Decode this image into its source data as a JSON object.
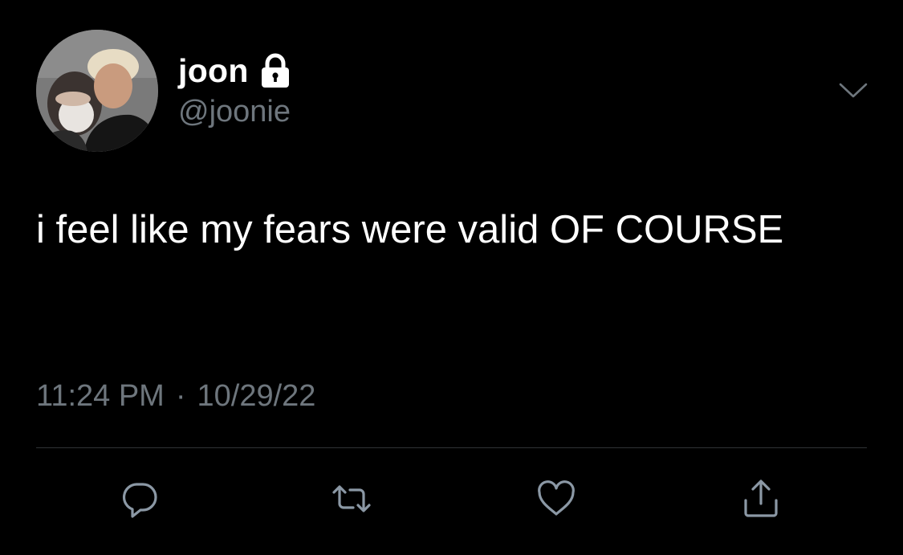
{
  "author": {
    "display_name": "joon",
    "handle": "@joonie",
    "protected": true,
    "avatar": "profile-photo"
  },
  "tweet": {
    "text": "i feel like my fears were valid OF COURSE",
    "time": "11:24 PM",
    "separator": "·",
    "date": "10/29/22"
  },
  "actions": [
    {
      "icon": "reply-icon"
    },
    {
      "icon": "retweet-icon"
    },
    {
      "icon": "like-icon"
    },
    {
      "icon": "share-icon"
    }
  ],
  "colors": {
    "background": "#000000",
    "text": "#ffffff",
    "secondary": "#6e767d",
    "divider": "#2f3336",
    "icon": "#8b98a5"
  }
}
